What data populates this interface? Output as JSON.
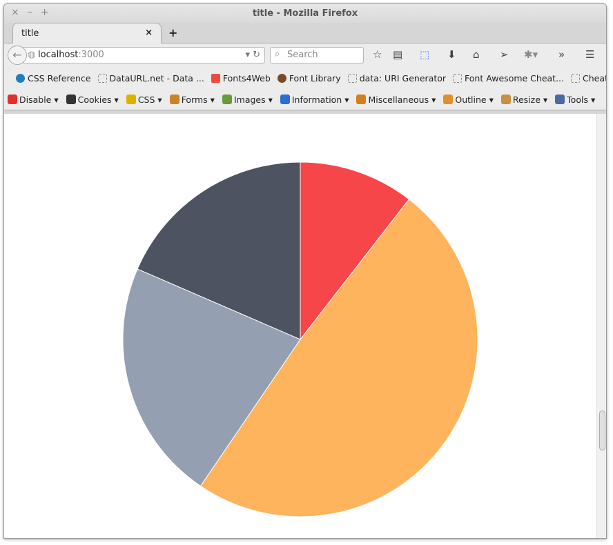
{
  "window": {
    "title": "title - Mozilla Firefox",
    "controls": [
      "×",
      "–",
      "+"
    ]
  },
  "tab": {
    "label": "title",
    "close": "×",
    "new_tab": "+"
  },
  "nav": {
    "url_host": "localhost",
    "url_port": ":3000",
    "search_placeholder": "Search"
  },
  "bookmarks": [
    "CSS Reference",
    "DataURL.net - Data ...",
    "Fonts4Web",
    "Font Library",
    "data: URI Generator",
    "Font Awesome Cheat...",
    "Cheat Sheet"
  ],
  "bookmarks_more": "»",
  "webdev": [
    "Disable",
    "Cookies",
    "CSS",
    "Forms",
    "Images",
    "Information",
    "Miscellaneous",
    "Outline",
    "Resize",
    "Tools"
  ],
  "webdev_icon_colors": [
    "#e0302a",
    "#333",
    "#d9b300",
    "#c8842a",
    "#6a9a3a",
    "#2a6fd0",
    "#d08020",
    "#e0902a",
    "#c89040",
    "#4a6aa0"
  ],
  "chart_data": {
    "type": "pie",
    "values": [
      10.5,
      49,
      22,
      18.5
    ],
    "colors": [
      "#F7464A",
      "#FDB45C",
      "#949FB1",
      "#4D5360"
    ],
    "start": "top, clockwise",
    "legend": "none"
  }
}
